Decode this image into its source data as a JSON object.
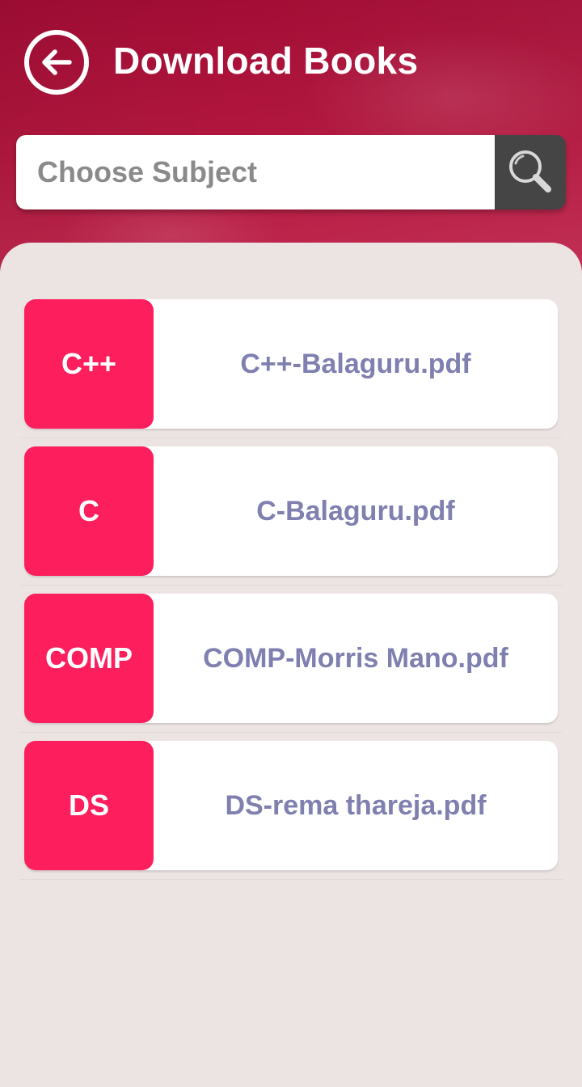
{
  "header": {
    "title": "Download Books",
    "back_icon": "arrow-left-circle-icon",
    "background_color": "#a30d35"
  },
  "search": {
    "placeholder": "Choose Subject",
    "value": "",
    "button_icon": "search-icon"
  },
  "books": [
    {
      "badge": "C++",
      "file": "C++-Balaguru.pdf"
    },
    {
      "badge": "C",
      "file": "C-Balaguru.pdf"
    },
    {
      "badge": "COMP",
      "file": "COMP-Morris Mano.pdf"
    },
    {
      "badge": "DS",
      "file": "DS-rema thareja.pdf"
    }
  ],
  "colors": {
    "badge": "#fd1f5d",
    "file_text": "#7f7fb0",
    "panel": "#ece4e3",
    "search_button": "#454545"
  }
}
